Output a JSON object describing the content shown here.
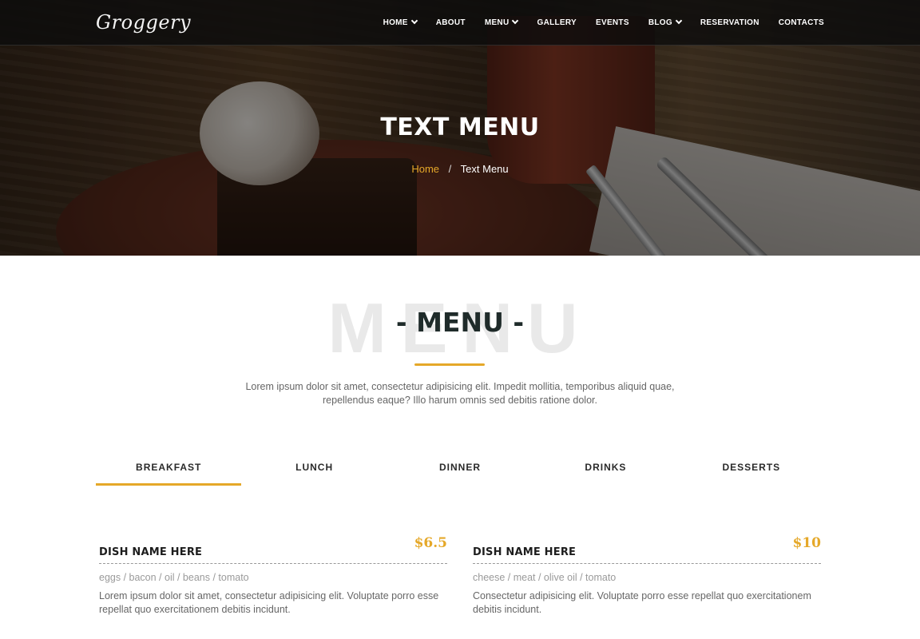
{
  "brand": {
    "logo": "Groggery",
    "accent": "#e5a829"
  },
  "nav": {
    "items": [
      {
        "label": "HOME",
        "dropdown": true
      },
      {
        "label": "ABOUT",
        "dropdown": false
      },
      {
        "label": "MENU",
        "dropdown": true
      },
      {
        "label": "GALLERY",
        "dropdown": false
      },
      {
        "label": "EVENTS",
        "dropdown": false
      },
      {
        "label": "BLOG",
        "dropdown": true
      },
      {
        "label": "RESERVATION",
        "dropdown": false
      },
      {
        "label": "CONTACTS",
        "dropdown": false
      }
    ]
  },
  "hero": {
    "title": "TEXT MENU",
    "breadcrumb": {
      "home": "Home",
      "separator": "/",
      "current": "Text Menu"
    }
  },
  "section": {
    "bg_word": "MENU",
    "title": "- MENU -",
    "description": "Lorem ipsum dolor sit amet, consectetur adipisicing elit. Impedit mollitia, temporibus aliquid quae, repellendus eaque? Illo harum omnis sed debitis ratione dolor."
  },
  "tabs": [
    {
      "label": "BREAKFAST",
      "active": true
    },
    {
      "label": "LUNCH",
      "active": false
    },
    {
      "label": "DINNER",
      "active": false
    },
    {
      "label": "DRINKS",
      "active": false
    },
    {
      "label": "DESSERTS",
      "active": false
    }
  ],
  "menu_items": [
    {
      "name": "DISH NAME HERE",
      "price": "$6.5",
      "ingredients": "eggs / bacon / oil / beans / tomato",
      "description": "Lorem ipsum dolor sit amet, consectetur adipisicing elit. Voluptate porro esse repellat quo exercitationem debitis incidunt."
    },
    {
      "name": "DISH NAME HERE",
      "price": "$10",
      "ingredients": "cheese / meat / olive oil / tomato",
      "description": "Consectetur adipisicing elit. Voluptate porro esse repellat quo exercitationem debitis incidunt."
    }
  ]
}
